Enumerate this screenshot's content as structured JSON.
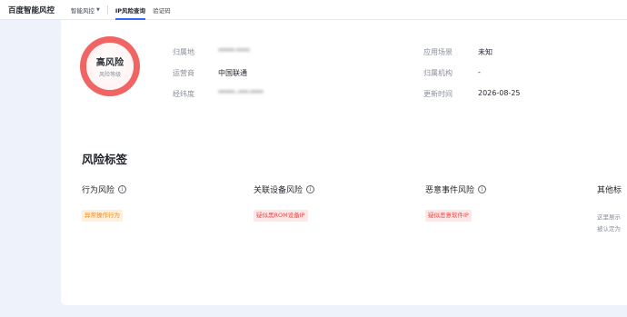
{
  "nav": {
    "brand": "百度智能风控",
    "items": [
      {
        "label": "智能风控",
        "chevron": "chevron-down-icon"
      },
      {
        "label": "IP风险查询"
      },
      {
        "label": "验证码"
      }
    ]
  },
  "risk": {
    "level": "高风险",
    "sub": "风险等级",
    "color": "#f06464"
  },
  "info": {
    "location_label": "归属地",
    "location_value": "*****·****",
    "carrier_label": "运营商",
    "carrier_value": "中国联通",
    "coords_label": "经纬度",
    "coords_value": "*****··***·****",
    "scene_label": "应用场景",
    "scene_value": "未知",
    "org_label": "归属机构",
    "org_value": "-",
    "updated_label": "更新时间",
    "updated_value": "2026-08-25"
  },
  "tags_section": {
    "title": "风险标签",
    "columns": [
      {
        "title": "行为风险",
        "icon": "info-icon",
        "tag": "异常操作行为",
        "tag_color": "#f08a24"
      },
      {
        "title": "关联设备风险",
        "icon": "info-icon",
        "tag": "疑似黑ROM设备IP",
        "tag_color": "#e84848"
      },
      {
        "title": "恶意事件风险",
        "icon": "info-icon",
        "tag": "疑似恶意软件IP",
        "tag_color": "#e84848"
      },
      {
        "title": "其他标",
        "desc_line1": "这里展示",
        "desc_line2": "被认定为"
      }
    ]
  }
}
